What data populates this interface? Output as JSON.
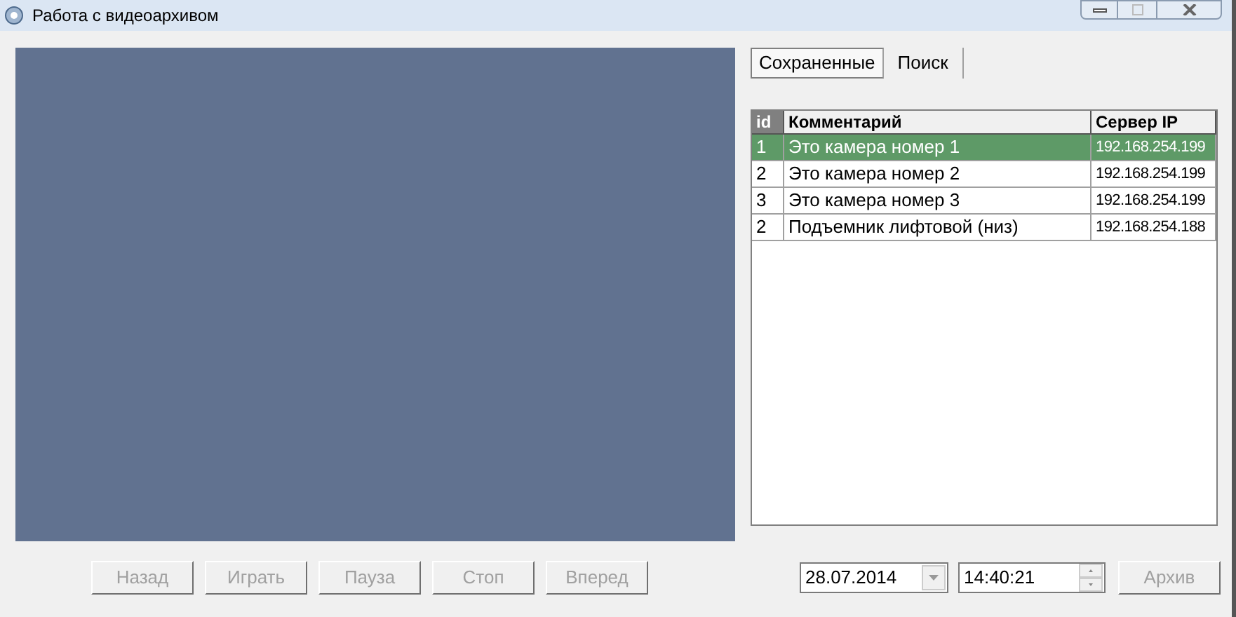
{
  "window": {
    "title": "Работа с видеоархивом"
  },
  "tabs": [
    {
      "label": "Сохраненные",
      "selected": true
    },
    {
      "label": "Поиск",
      "selected": false
    }
  ],
  "table": {
    "columns": [
      "id",
      "Комментарий",
      "Сервер IP"
    ],
    "rows": [
      {
        "cells": [
          "1",
          "Это камера номер 1",
          "192.168.254.199"
        ],
        "selected": true
      },
      {
        "cells": [
          "2",
          "Это камера номер 2",
          "192.168.254.199"
        ],
        "selected": false
      },
      {
        "cells": [
          "3",
          "Это камера номер 3",
          "192.168.254.199"
        ],
        "selected": false
      },
      {
        "cells": [
          "2",
          "Подъемник лифтовой (низ)",
          "192.168.254.188"
        ],
        "selected": false
      }
    ]
  },
  "controls": [
    {
      "label": "Назад",
      "disabled": true
    },
    {
      "label": "Играть",
      "disabled": true
    },
    {
      "label": "Пауза",
      "disabled": true
    },
    {
      "label": "Стоп",
      "disabled": true
    },
    {
      "label": "Вперед",
      "disabled": true
    }
  ],
  "date": {
    "value": "28.07.2014"
  },
  "time": {
    "value": "14:40:21"
  },
  "archive_button": {
    "label": "Архив",
    "disabled": true
  }
}
